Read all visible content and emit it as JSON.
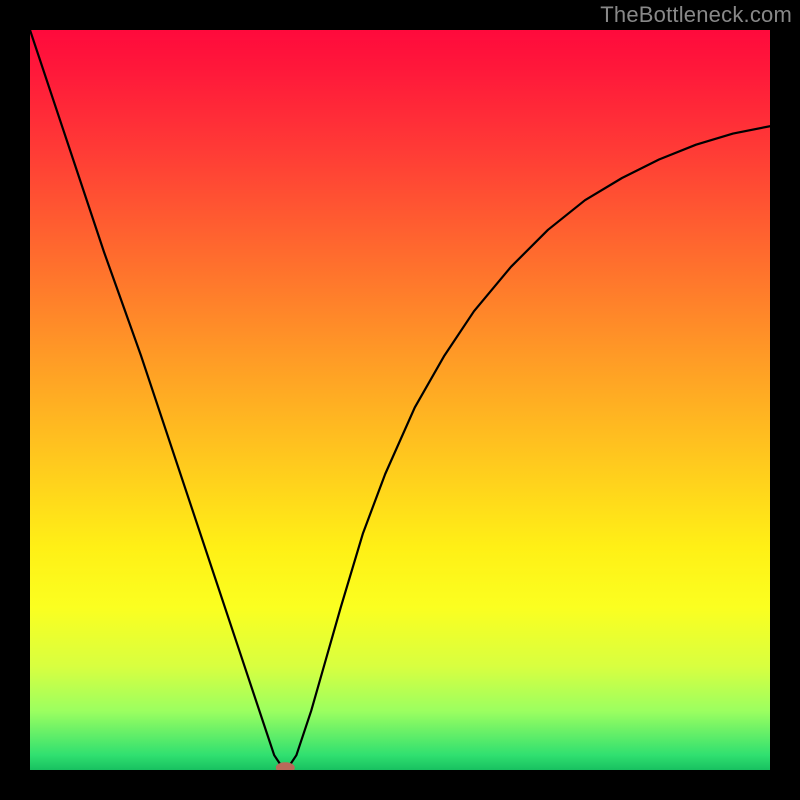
{
  "watermark": "TheBottleneck.com",
  "colors": {
    "frame_bg": "#000000",
    "curve_stroke": "#000000",
    "marker_fill": "#b96a5a",
    "gradient_top": "#ff0a3c",
    "gradient_bottom": "#18c060"
  },
  "chart_data": {
    "type": "line",
    "title": "",
    "xlabel": "",
    "ylabel": "",
    "xlim": [
      0,
      100
    ],
    "ylim": [
      0,
      100
    ],
    "grid": false,
    "legend": false,
    "annotations": [],
    "series": [
      {
        "name": "bottleneck-curve",
        "x": [
          0,
          5,
          10,
          15,
          20,
          25,
          28,
          30,
          32,
          33,
          34,
          35,
          36,
          38,
          40,
          42,
          45,
          48,
          52,
          56,
          60,
          65,
          70,
          75,
          80,
          85,
          90,
          95,
          100
        ],
        "y": [
          100,
          85,
          70,
          56,
          41,
          26,
          17,
          11,
          5,
          2,
          0.5,
          0.5,
          2,
          8,
          15,
          22,
          32,
          40,
          49,
          56,
          62,
          68,
          73,
          77,
          80,
          82.5,
          84.5,
          86,
          87
        ]
      }
    ],
    "marker": {
      "x": 34.5,
      "y": 0.3,
      "label": ""
    }
  }
}
